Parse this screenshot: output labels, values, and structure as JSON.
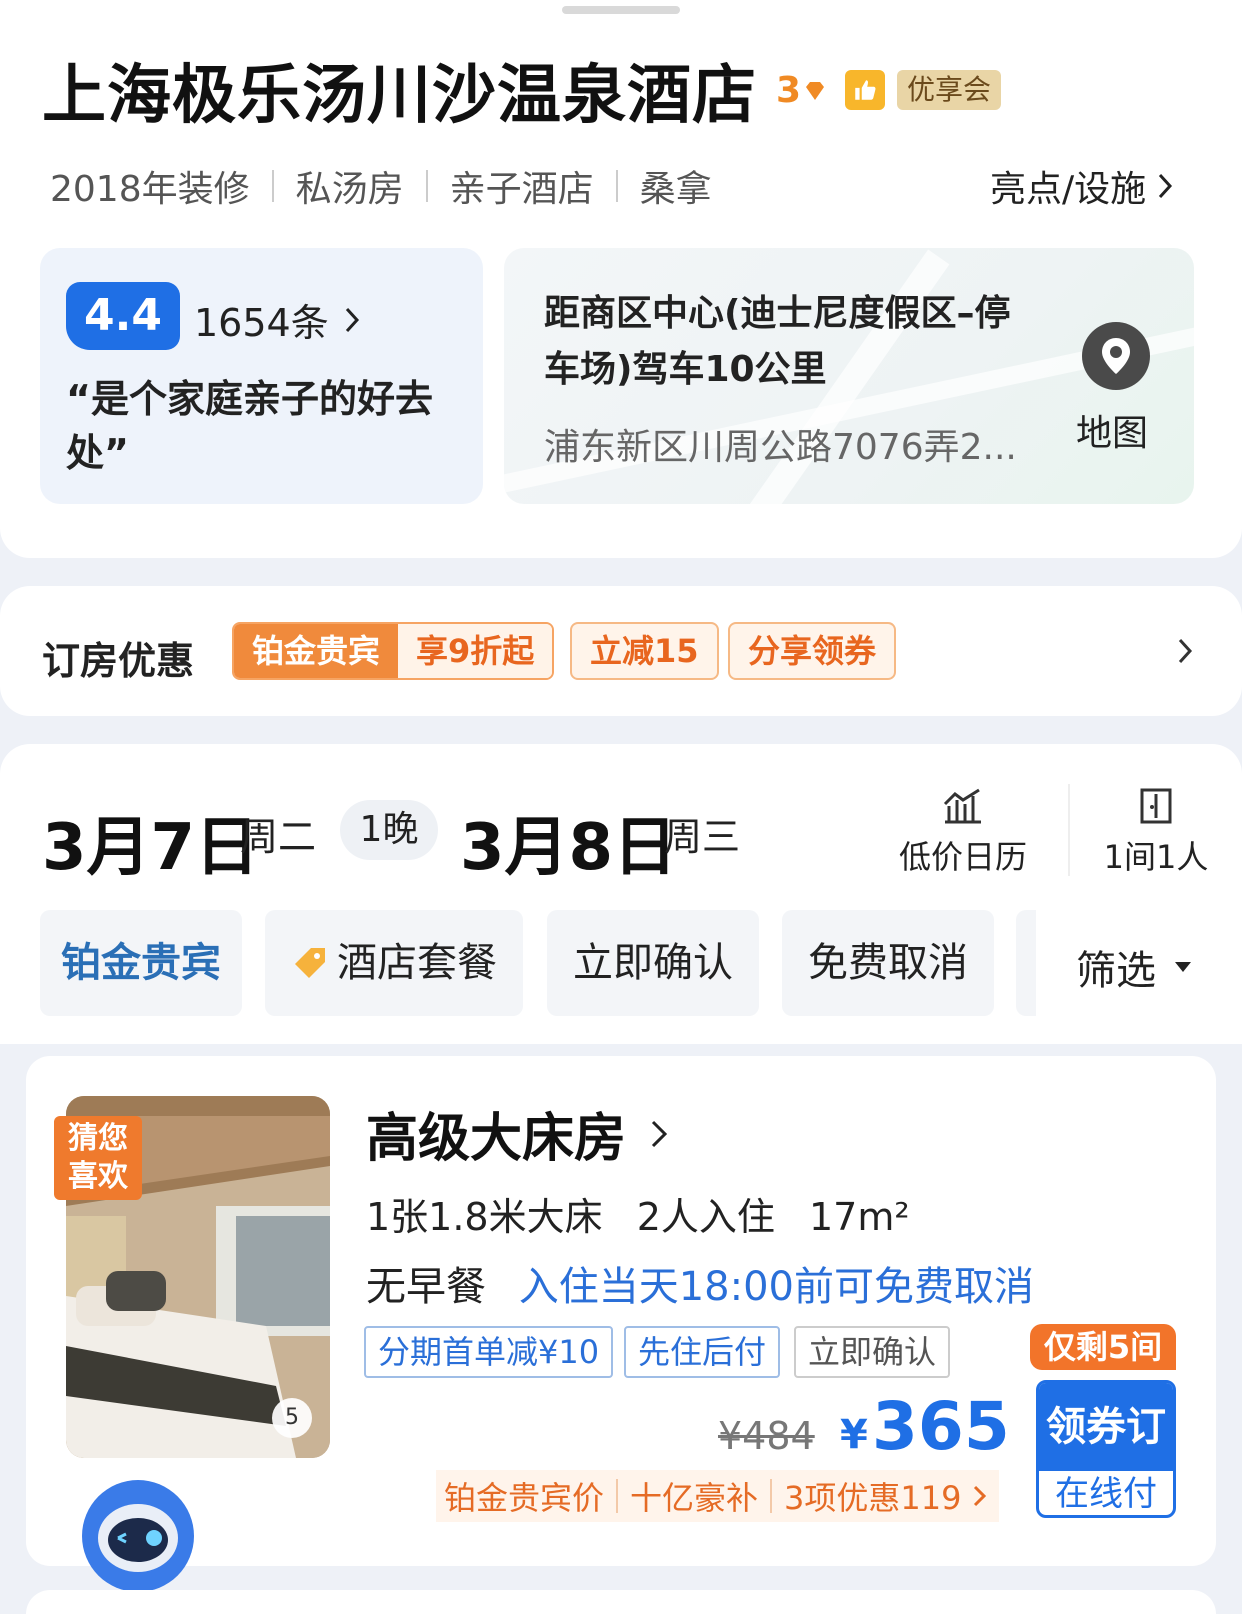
{
  "hotel": {
    "name": "上海极乐汤川沙温泉酒店",
    "star_level": "3",
    "member_badge": "优享会",
    "tags": [
      "2018年装修",
      "私汤房",
      "亲子酒店",
      "桑拿"
    ],
    "facilities_link": "亮点/设施"
  },
  "review": {
    "score": "4.4",
    "count": "1654条",
    "quote": "“是个家庭亲子的好去处”"
  },
  "location": {
    "distance": "距商区中心(迪士尼度假区–停车场)驾车10公里",
    "address": "浦东新区川周公路7076弄2...",
    "map_label": "地图"
  },
  "promo": {
    "title": "订房优惠",
    "platinum_label": "铂金贵宾",
    "platinum_discount": "享9折起",
    "instant_cut": "立减15",
    "share_coupon": "分享领券"
  },
  "dates": {
    "checkin_date": "3月7日",
    "checkin_weekday": "周二",
    "nights": "1晚",
    "checkout_date": "3月8日",
    "checkout_weekday": "周三",
    "calendar_label": "低价日历",
    "rooms_guests": "1间1人"
  },
  "filters": [
    "铂金贵宾",
    "酒店套餐",
    "立即确认",
    "免费取消"
  ],
  "filter_select": "筛选",
  "room": {
    "guess_tag": "猜您喜欢",
    "image_count": "5",
    "name": "高级大床房",
    "bed": "1张1.8米大床",
    "occupancy": "2人入住",
    "area": "17m²",
    "meal": "无早餐",
    "cancel_policy": "入住当天18:00前可免费取消",
    "tags": [
      "分期首单减¥10",
      "先住后付",
      "立即确认"
    ],
    "original_price": "¥484",
    "currency": "¥",
    "price": "365",
    "benefits": [
      "铂金贵宾价",
      "十亿豪补",
      "3项优惠119"
    ],
    "scarcity": "仅剩5间",
    "book_label": "领券订",
    "pay_label": "在线付"
  },
  "colors": {
    "accent_blue": "#1f6fe5",
    "accent_orange": "#f08a3c",
    "page_bg": "#eef1f7"
  }
}
